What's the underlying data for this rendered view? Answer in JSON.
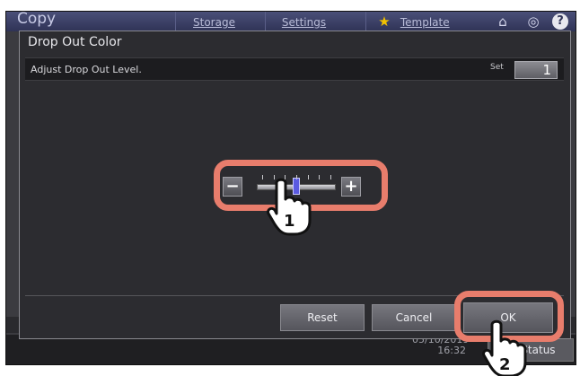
{
  "app": {
    "title": "Copy",
    "tabs": [
      "Storage",
      "Settings",
      "Template"
    ],
    "clock_date": "05/10/2019",
    "clock_time": "16:32",
    "job_status_label": "Job Status"
  },
  "dialog": {
    "title": "Drop Out Color",
    "instruction": "Adjust Drop Out Level.",
    "set_label": "Set",
    "set_value": "1"
  },
  "level_control": {
    "minus_label": "−",
    "plus_label": "+",
    "tick_count": 7,
    "level_fraction": 0.5
  },
  "buttons": {
    "reset": "Reset",
    "cancel": "Cancel",
    "ok": "OK"
  },
  "callouts": [
    "1",
    "2"
  ],
  "colors": {
    "highlight": "#e87d6c",
    "accent_topbar": "#2f3356",
    "slider_thumb": "#5a5ae0"
  }
}
